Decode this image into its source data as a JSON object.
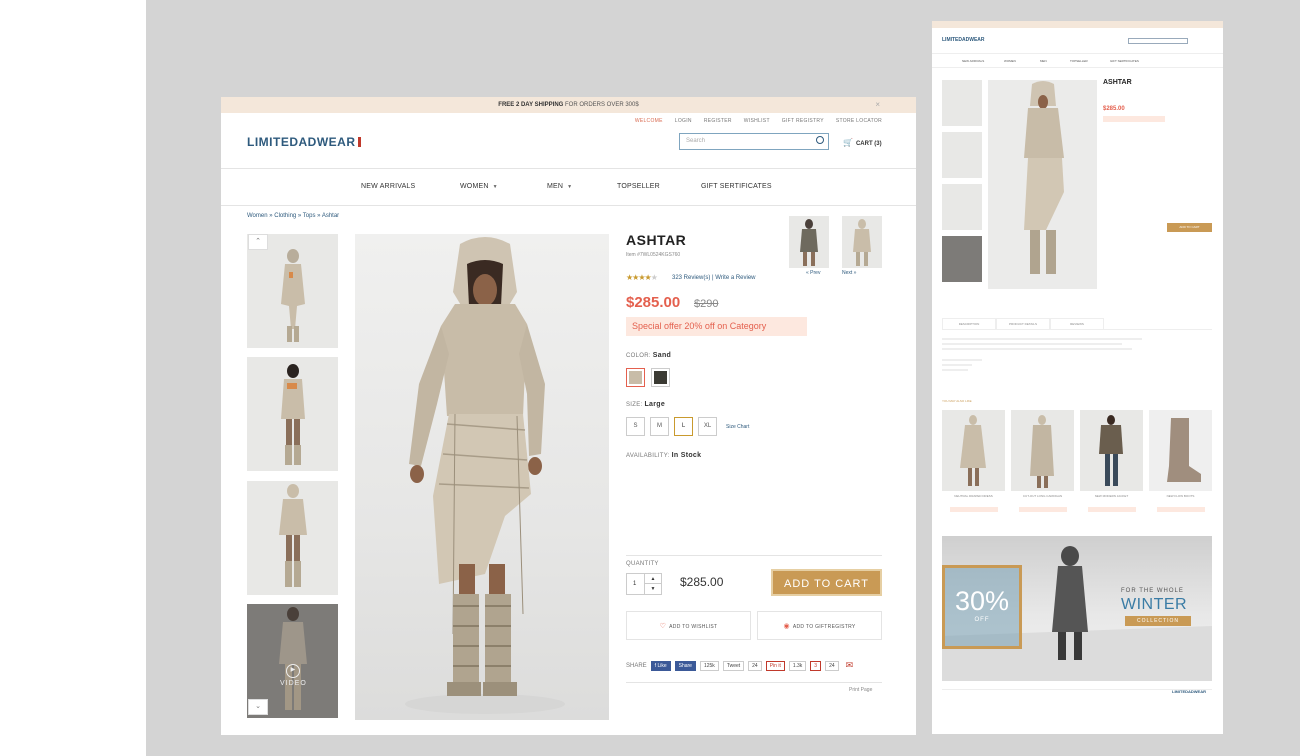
{
  "banner": {
    "bold": "FREE 2 DAY SHIPPING",
    "rest": "FOR ORDERS OVER 300$",
    "close": "×"
  },
  "utility": [
    "WELCOME",
    "LOGIN",
    "REGISTER",
    "WISHLIST",
    "GIFT REGISTRY",
    "STORE LOCATOR"
  ],
  "logo": "LIMITEDADWEAR",
  "search": {
    "placeholder": "Search"
  },
  "cart": {
    "label": "CART (3)"
  },
  "nav": [
    "NEW ARRIVALS",
    "WOMEN",
    "MEN",
    "TOPSELLER",
    "GIFT SERTIFICATES"
  ],
  "breadcrumb": "Women » Clothing » Tops » Ashtar",
  "video_label": "VIDEO",
  "product": {
    "title": "ASHTAR",
    "item_no": "Item #7WL0524KGS760",
    "rating": 4,
    "reviews": "323 Review(s)",
    "write_review": "Write a Review",
    "price": "$285.00",
    "old_price": "$290",
    "offer": "Special offer 20% off on Category",
    "color_label": "COLOR:",
    "color_value": "Sand",
    "colors": [
      "#c8bca8",
      "#3b3a33"
    ],
    "size_label": "SIZE:",
    "size_value": "Large",
    "sizes": [
      "S",
      "M",
      "L",
      "XL"
    ],
    "size_chart": "Size Chart",
    "availability_label": "AVAILABILITY:",
    "availability_value": "In Stock",
    "quantity_label": "QUANTITY",
    "quantity": "1",
    "cart_price": "$285.00",
    "add_to_cart": "ADD TO CART",
    "wishlist": "ADD TO WISHLIST",
    "giftregistry": "ADD TO GIFTREGISTRY",
    "share_label": "SHARE",
    "share": [
      "f Like",
      "Share",
      "125k",
      "Tweet",
      "24",
      "Pin it",
      "1.3k",
      "3",
      "24"
    ],
    "print": "Print Page",
    "prev": "« Prev",
    "next": "Next »"
  },
  "side": {
    "title": "ASHTAR",
    "price": "$285.00",
    "add": "ADD TO CART",
    "tabs": [
      "DESCRIPTION",
      "PRODUCT DETAILS",
      "REVIEWS"
    ],
    "you_may_like": "YOU MAY ALSO LIKE",
    "products": [
      "NEUTRAL DRAPED DRESS",
      "CUT-OUT LONG CARDIGAN",
      "NEW MODERN JACKET",
      "NEW FLOW BOOTS"
    ],
    "banner_pct": "30%",
    "banner_off": "OFF",
    "banner_for": "FOR THE WHOLE",
    "banner_winter": "WINTER",
    "banner_collection": "COLLECTION",
    "footer_logo": "LIMITEDADWEAR"
  },
  "colors": {
    "accent": "#e4604e",
    "brand": "#2e5a7d",
    "gold": "#c99a55",
    "banner_bg": "#f4e7da"
  }
}
